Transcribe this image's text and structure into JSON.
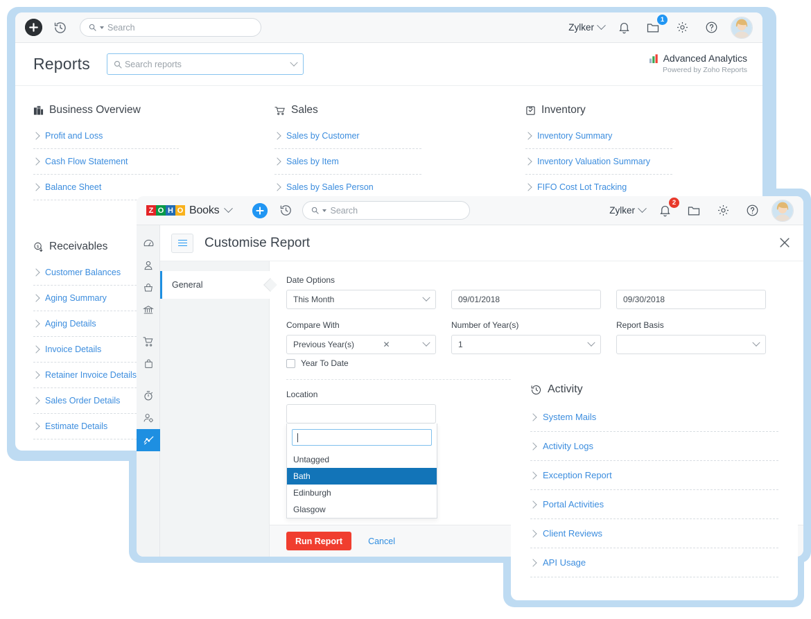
{
  "reports_window": {
    "topbar": {
      "add_icon": "plus-circle-icon",
      "history_icon": "history-clock-icon",
      "search_placeholder": "Search",
      "org_name": "Zylker",
      "notifications_icon": "bell-icon",
      "folder_icon": "folder-icon",
      "folder_badge": "1",
      "settings_icon": "gear-icon",
      "help_icon": "help-circle-icon",
      "avatar": "user-avatar"
    },
    "page_title": "Reports",
    "reports_search_placeholder": "Search reports",
    "analytics": {
      "title": "Advanced Analytics",
      "subtitle": "Powered by Zoho Reports",
      "icon": "bar-chart-icon"
    },
    "categories": [
      {
        "title": "Business Overview",
        "icon": "building-icon",
        "items": [
          "Profit and Loss",
          "Cash Flow Statement",
          "Balance Sheet"
        ]
      },
      {
        "title": "Sales",
        "icon": "shopping-cart-icon",
        "items": [
          "Sales by Customer",
          "Sales by Item",
          "Sales by Sales Person"
        ]
      },
      {
        "title": "Inventory",
        "icon": "inventory-box-icon",
        "items": [
          "Inventory Summary",
          "Inventory Valuation Summary",
          "FIFO Cost Lot Tracking"
        ]
      },
      {
        "title": "Receivables",
        "icon": "receivables-icon",
        "items": [
          "Customer Balances",
          "Aging Summary",
          "Aging Details",
          "Invoice Details",
          "Retainer Invoice Details",
          "Sales Order Details",
          "Estimate Details"
        ]
      }
    ]
  },
  "books_window": {
    "topbar": {
      "logo_tiles": [
        {
          "letter": "Z",
          "color": "#e42527"
        },
        {
          "letter": "O",
          "color": "#089949"
        },
        {
          "letter": "H",
          "color": "#226db4"
        },
        {
          "letter": "O",
          "color": "#f9b21d"
        }
      ],
      "product": "Books",
      "add_icon": "plus-circle-icon",
      "history_icon": "history-clock-icon",
      "search_placeholder": "Search",
      "org_name": "Zylker",
      "notifications_icon": "bell-icon",
      "notifications_badge": "2",
      "folder_icon": "folder-icon",
      "settings_icon": "gear-icon",
      "help_icon": "help-circle-icon",
      "avatar": "user-avatar"
    },
    "rail_icons": [
      "dashboard-icon",
      "customers-icon",
      "basket-icon",
      "bank-icon",
      "shopping-cart-icon",
      "purchases-bag-icon",
      "timesheet-timer-icon",
      "accountant-icon",
      "reports-chart-icon"
    ],
    "menu_icon": "hamburger-icon",
    "title": "Customise Report",
    "close_icon": "close-icon",
    "side_tabs": [
      "General"
    ],
    "form": {
      "date_options_label": "Date Options",
      "date_options_value": "This Month",
      "start_date": "09/01/2018",
      "end_date": "09/30/2018",
      "compare_with_label": "Compare With",
      "compare_with_value": "Previous Year(s)",
      "compare_clear_icon": "clear-x-icon",
      "number_of_years_label": "Number of Year(s)",
      "number_of_years_value": "1",
      "report_basis_label": "Report Basis",
      "report_basis_value": "",
      "year_to_date_label": "Year To Date",
      "year_to_date_checked": false,
      "location_label": "Location",
      "location_value": "",
      "location_filter_value": "",
      "location_options": [
        {
          "label": "Untagged",
          "selected": false
        },
        {
          "label": "Bath",
          "selected": true
        },
        {
          "label": "Edinburgh",
          "selected": false
        },
        {
          "label": "Glasgow",
          "selected": false
        }
      ]
    },
    "footer": {
      "run_label": "Run Report",
      "cancel_label": "Cancel"
    }
  },
  "activity_window": {
    "title": "Activity",
    "icon": "history-clock-icon",
    "items": [
      "System Mails",
      "Activity Logs",
      "Exception Report",
      "Portal Activities",
      "Client Reviews",
      "API Usage"
    ]
  },
  "colors": {
    "backdrop_blue": "#bedbf2",
    "link_blue": "#3c8dde",
    "accent_blue": "#1e8fe1",
    "primary_red": "#f03e2f",
    "dropdown_selected": "#1274b8",
    "badge_blue": "#2196f3",
    "badge_red": "#e8392b"
  }
}
